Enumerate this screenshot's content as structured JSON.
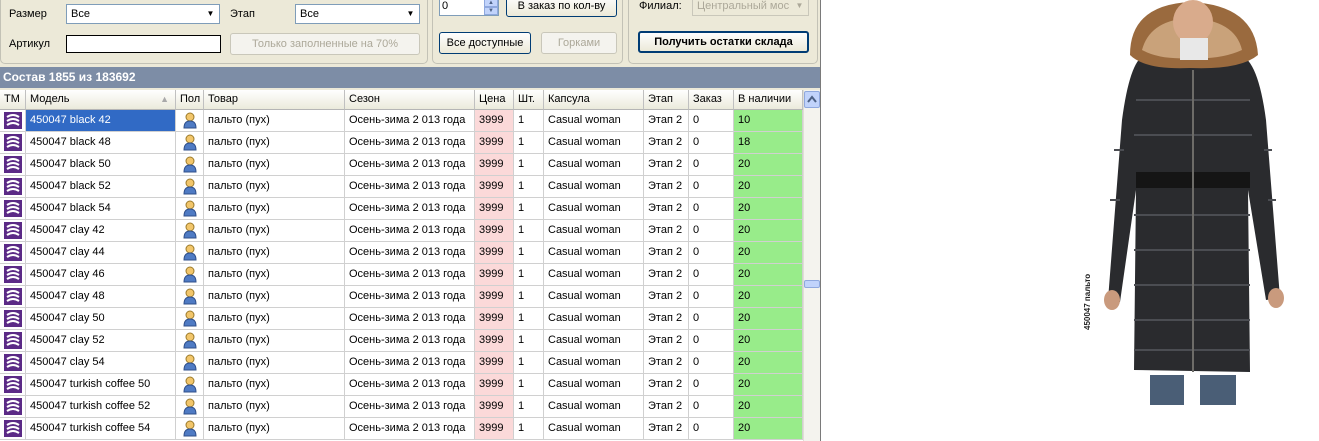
{
  "filters": {
    "size_label": "Размер",
    "size_value": "Все",
    "stage_label": "Этап",
    "stage_value": "Все",
    "article_label": "Артикул",
    "article_value": "",
    "filled_button": "Только заполненные на 70%"
  },
  "order": {
    "qty_value": "0",
    "to_order_button": "В заказ по кол-ву",
    "all_available_button": "Все доступные",
    "slides_button": "Горками"
  },
  "branch": {
    "label": "Филиал:",
    "value": "Центральный мос",
    "get_stock_button": "Получить остатки склада"
  },
  "summary": {
    "text": "Состав 1855 из 183692"
  },
  "table": {
    "columns": [
      "ТМ",
      "Модель",
      "Пол",
      "Товар",
      "Сезон",
      "Цена",
      "Шт.",
      "Капсула",
      "Этап",
      "Заказ",
      "В наличии"
    ],
    "rows": [
      {
        "model": "450047 black  42",
        "product": "пальто (пух)",
        "season": "Осень-зима 2 013 года",
        "price": "3999",
        "qty": "1",
        "capsule": "Casual woman",
        "stage": "Этап 2",
        "order": "0",
        "stock": "10"
      },
      {
        "model": "450047 black  48",
        "product": "пальто (пух)",
        "season": "Осень-зима 2 013 года",
        "price": "3999",
        "qty": "1",
        "capsule": "Casual woman",
        "stage": "Этап 2",
        "order": "0",
        "stock": "18"
      },
      {
        "model": "450047 black  50",
        "product": "пальто (пух)",
        "season": "Осень-зима 2 013 года",
        "price": "3999",
        "qty": "1",
        "capsule": "Casual woman",
        "stage": "Этап 2",
        "order": "0",
        "stock": "20"
      },
      {
        "model": "450047 black  52",
        "product": "пальто (пух)",
        "season": "Осень-зима 2 013 года",
        "price": "3999",
        "qty": "1",
        "capsule": "Casual woman",
        "stage": "Этап 2",
        "order": "0",
        "stock": "20"
      },
      {
        "model": "450047 black  54",
        "product": "пальто (пух)",
        "season": "Осень-зима 2 013 года",
        "price": "3999",
        "qty": "1",
        "capsule": "Casual woman",
        "stage": "Этап 2",
        "order": "0",
        "stock": "20"
      },
      {
        "model": "450047 clay  42",
        "product": "пальто (пух)",
        "season": "Осень-зима 2 013 года",
        "price": "3999",
        "qty": "1",
        "capsule": "Casual woman",
        "stage": "Этап 2",
        "order": "0",
        "stock": "20"
      },
      {
        "model": "450047 clay  44",
        "product": "пальто (пух)",
        "season": "Осень-зима 2 013 года",
        "price": "3999",
        "qty": "1",
        "capsule": "Casual woman",
        "stage": "Этап 2",
        "order": "0",
        "stock": "20"
      },
      {
        "model": "450047 clay  46",
        "product": "пальто (пух)",
        "season": "Осень-зима 2 013 года",
        "price": "3999",
        "qty": "1",
        "capsule": "Casual woman",
        "stage": "Этап 2",
        "order": "0",
        "stock": "20"
      },
      {
        "model": "450047 clay  48",
        "product": "пальто (пух)",
        "season": "Осень-зима 2 013 года",
        "price": "3999",
        "qty": "1",
        "capsule": "Casual woman",
        "stage": "Этап 2",
        "order": "0",
        "stock": "20"
      },
      {
        "model": "450047 clay  50",
        "product": "пальто (пух)",
        "season": "Осень-зима 2 013 года",
        "price": "3999",
        "qty": "1",
        "capsule": "Casual woman",
        "stage": "Этап 2",
        "order": "0",
        "stock": "20"
      },
      {
        "model": "450047 clay  52",
        "product": "пальто (пух)",
        "season": "Осень-зима 2 013 года",
        "price": "3999",
        "qty": "1",
        "capsule": "Casual woman",
        "stage": "Этап 2",
        "order": "0",
        "stock": "20"
      },
      {
        "model": "450047 clay  54",
        "product": "пальто (пух)",
        "season": "Осень-зима 2 013 года",
        "price": "3999",
        "qty": "1",
        "capsule": "Casual woman",
        "stage": "Этап 2",
        "order": "0",
        "stock": "20"
      },
      {
        "model": "450047 turkish coffee  50",
        "product": "пальто (пух)",
        "season": "Осень-зима 2 013 года",
        "price": "3999",
        "qty": "1",
        "capsule": "Casual woman",
        "stage": "Этап 2",
        "order": "0",
        "stock": "20"
      },
      {
        "model": "450047 turkish coffee  52",
        "product": "пальто (пух)",
        "season": "Осень-зима 2 013 года",
        "price": "3999",
        "qty": "1",
        "capsule": "Casual woman",
        "stage": "Этап 2",
        "order": "0",
        "stock": "20"
      },
      {
        "model": "450047 turkish coffee  54",
        "product": "пальто (пух)",
        "season": "Осень-зима 2 013 года",
        "price": "3999",
        "qty": "1",
        "capsule": "Casual woman",
        "stage": "Этап 2",
        "order": "0",
        "stock": "20"
      }
    ]
  },
  "photo": {
    "caption": "450047 пальто"
  },
  "colors": {
    "panel_bg": "#ece9d8",
    "title_bar": "#7d8da6",
    "price_cell": "#fbd9d9",
    "stock_cell": "#98ec8a",
    "selection": "#316ac5",
    "tm_icon": "#5b2a86"
  },
  "icons": {
    "tm": "brand-tm-icon",
    "gender": "female-user-icon"
  }
}
